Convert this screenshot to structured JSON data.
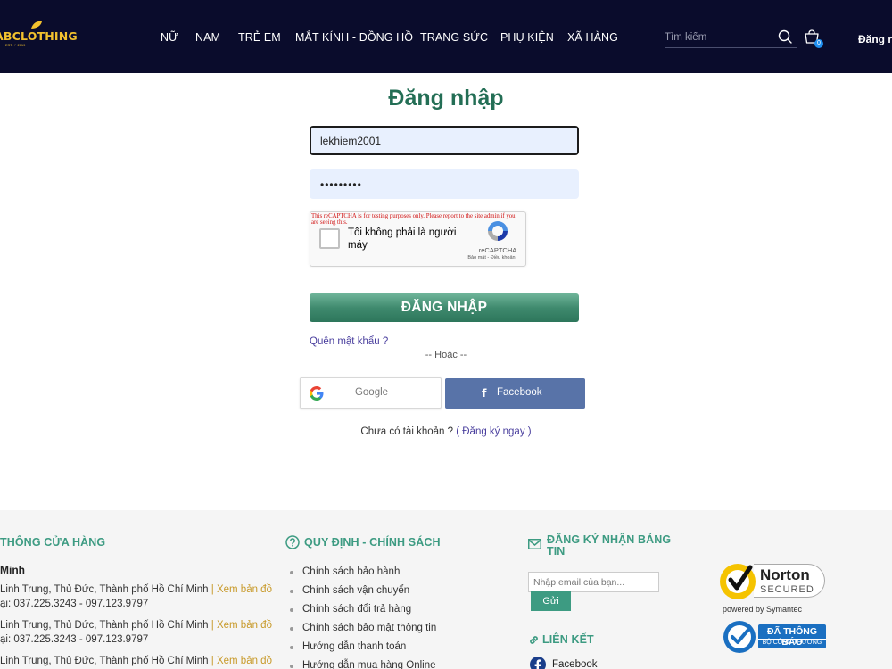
{
  "header": {
    "logo_text": "ABCLOTHING",
    "logo_sub": "EST. ⚡ 2019",
    "nav": [
      "NỮ",
      "NAM",
      "TRẺ EM",
      "MẮT KÍNH - ĐỒNG HỒ",
      "TRANG SỨC",
      "PHỤ KIỆN",
      "XÃ HÀNG"
    ],
    "search_placeholder": "Tìm kiếm",
    "cart_count": "0",
    "login_label": "Đăng n"
  },
  "login": {
    "title": "Đăng nhập",
    "username": "lekhiem2001",
    "password": "lekhiem20",
    "captcha_warning": "This reCAPTCHA is for testing purposes only. Please report to the site admin if you are seeing this.",
    "captcha_label": "Tôi không phải là người máy",
    "captcha_brand": "reCAPTCHA",
    "captcha_links": "Bảo mật - Điều khoản",
    "submit_label": "ĐĂNG NHẬP",
    "forgot_label": "Quên mật khẩu ?",
    "or_label": "-- Hoặc --",
    "google_label": "Google",
    "facebook_label": "Facebook",
    "no_account_label": "Chưa có tài khoản ?",
    "register_label": "( Đăng ký ngay )"
  },
  "footer": {
    "store_title": "THÔNG CỬA HÀNG",
    "store_city": "Minh",
    "store_rows": [
      {
        "address": "Linh Trung, Thủ Đức, Thành phố Hồ Chí Minh",
        "map": "| Xem bản đồ",
        "phone": "ại: 037.225.3243 - 097.123.9797"
      },
      {
        "address": "Linh Trung, Thủ Đức, Thành phố Hồ Chí Minh",
        "map": "| Xem bản đồ",
        "phone": "ại: 037.225.3243 - 097.123.9797"
      },
      {
        "address": "Linh Trung, Thủ Đức, Thành phố Hồ Chí Minh",
        "map": "| Xem bản đồ"
      }
    ],
    "policy_title": "QUY ĐỊNH - CHÍNH SÁCH",
    "policies": [
      "Chính sách bảo hành",
      "Chính sách vận chuyển",
      "Chính sách đổi trả hàng",
      "Chính sách bảo mật thông tin",
      "Hướng dẫn thanh toán",
      "Hướng dẫn mua hàng Online"
    ],
    "newsletter_title": "ĐĂNG KÝ NHẬN BẢNG TIN",
    "email_placeholder": "Nhập email của bạn...",
    "send_label": "Gửi",
    "links_title": "LIÊN KẾT",
    "facebook_link": "Facebook",
    "norton": {
      "name": "Norton",
      "secured": "SECURED",
      "powered": "powered by Symantec"
    },
    "bct": {
      "main": "ĐÃ THÔNG BÁO",
      "sub": "BỘ CÔNG THƯƠNG"
    }
  },
  "colors": {
    "header_bg": "#0a0c2c",
    "accent_green": "#236e55",
    "footer_accent": "#3d9b82",
    "facebook": "#5873a8",
    "logo_yellow": "#f2c12e"
  }
}
